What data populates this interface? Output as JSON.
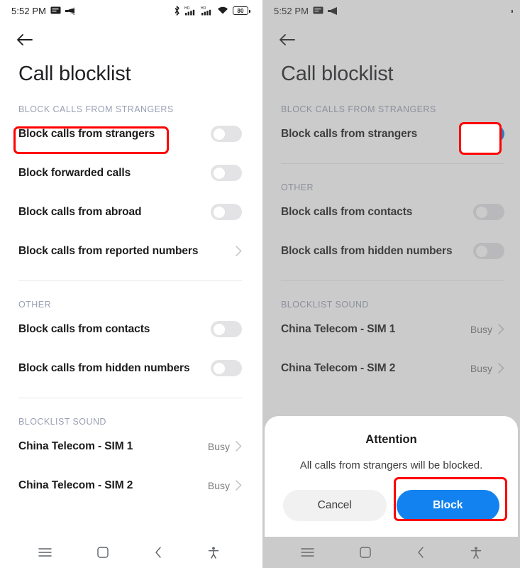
{
  "status_bar": {
    "time": "5:52 PM",
    "battery_level": "80",
    "left_icons": [
      "message-icon",
      "volume-mute-icon"
    ],
    "right_icons": [
      "bluetooth-icon",
      "signal-hd-1-icon",
      "signal-hd-2-icon",
      "wifi-icon",
      "battery-icon"
    ]
  },
  "app": {
    "title": "Call blocklist",
    "back_icon": "back-arrow-icon"
  },
  "left_panel": {
    "sections": [
      {
        "header": "BLOCK CALLS FROM STRANGERS",
        "rows": [
          {
            "label": "Block calls from strangers",
            "control": "toggle",
            "state": "off",
            "highlighted": true
          },
          {
            "label": "Block forwarded calls",
            "control": "toggle",
            "state": "off"
          },
          {
            "label": "Block calls from abroad",
            "control": "toggle",
            "state": "off"
          },
          {
            "label": "Block calls from reported numbers",
            "control": "chevron"
          }
        ]
      },
      {
        "header": "OTHER",
        "rows": [
          {
            "label": "Block calls from contacts",
            "control": "toggle",
            "state": "off"
          },
          {
            "label": "Block calls from hidden numbers",
            "control": "toggle",
            "state": "off"
          }
        ]
      },
      {
        "header": "BLOCKLIST SOUND",
        "rows": [
          {
            "label": "China Telecom - SIM 1",
            "control": "value",
            "value": "Busy"
          },
          {
            "label": "China Telecom - SIM 2",
            "control": "value",
            "value": "Busy"
          }
        ]
      }
    ]
  },
  "right_panel": {
    "dimmed": true,
    "sections": [
      {
        "header": "BLOCK CALLS FROM STRANGERS",
        "rows": [
          {
            "label": "Block calls from strangers",
            "control": "toggle",
            "state": "on",
            "highlighted": true
          }
        ]
      },
      {
        "header": "OTHER",
        "rows": [
          {
            "label": "Block calls from contacts",
            "control": "toggle",
            "state": "off"
          },
          {
            "label": "Block calls from hidden numbers",
            "control": "toggle",
            "state": "off"
          }
        ]
      },
      {
        "header": "BLOCKLIST SOUND",
        "rows": [
          {
            "label": "China Telecom - SIM 1",
            "control": "value",
            "value": "Busy"
          },
          {
            "label": "China Telecom - SIM 2",
            "control": "value",
            "value": "Busy"
          }
        ]
      }
    ],
    "dialog": {
      "title": "Attention",
      "message": "All calls from strangers will be blocked.",
      "cancel_label": "Cancel",
      "confirm_label": "Block",
      "confirm_highlighted": true
    }
  },
  "nav_bar": {
    "items": [
      "menu-icon",
      "home-square-icon",
      "back-chevron-icon",
      "accessibility-icon"
    ]
  },
  "colors": {
    "accent_blue": "#0b7ae5",
    "button_blue": "#1282f0",
    "annotation_red": "#ff0000",
    "section_header": "#9aa0b4",
    "toggle_off": "#e3e3e5"
  }
}
